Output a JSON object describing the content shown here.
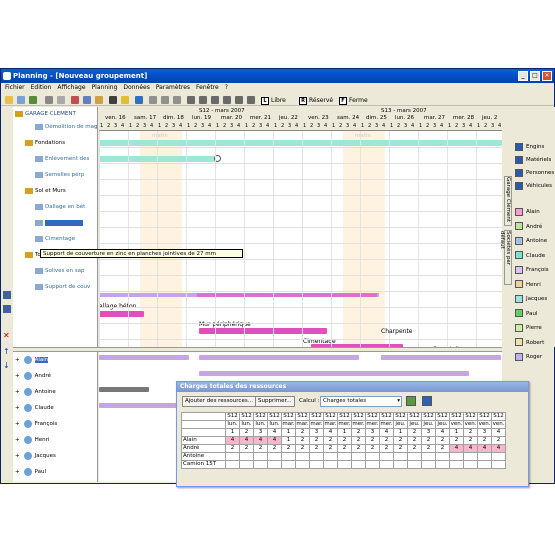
{
  "window": {
    "title": "Planning - [Nouveau groupement]",
    "min": "_",
    "max": "□",
    "close": "✕"
  },
  "menu": [
    "Fichier",
    "Edition",
    "Affichage",
    "Planning",
    "Données",
    "Paramètres",
    "Fenêtre",
    "?"
  ],
  "toolbar": {
    "modes": [
      {
        "key": "L",
        "label": "Libre"
      },
      {
        "key": "R",
        "label": "Réservé"
      },
      {
        "key": "F",
        "label": "Ferme"
      }
    ]
  },
  "timeline": {
    "weeks": [
      {
        "label": "S12 - mars 2007"
      },
      {
        "label": "S13 - mars 2007"
      }
    ],
    "days": [
      "ven. 16",
      "sam. 17",
      "dim. 18",
      "lun. 19",
      "mar. 20",
      "mer. 21",
      "jeu. 22",
      "ven. 23",
      "sam. 24",
      "dim. 25",
      "lun. 26",
      "mar. 27",
      "mer. 28",
      "jeu. 2"
    ],
    "weekend_label": "matin"
  },
  "tree": [
    {
      "label": "GARAGE CLEMENT",
      "level": 0
    },
    {
      "label": "Démolition de mag",
      "level": 2
    },
    {
      "label": "Fondations",
      "level": 1
    },
    {
      "label": "Enlèvement des",
      "level": 2
    },
    {
      "label": "Semelles pérp",
      "level": 2
    },
    {
      "label": "Sol et Murs",
      "level": 1
    },
    {
      "label": "Dallage en bét",
      "level": 2
    },
    {
      "label": "Mur en parpai",
      "level": 2,
      "selected": true
    },
    {
      "label": "Cimentage",
      "level": 2
    },
    {
      "label": "Toiture",
      "level": 1
    },
    {
      "label": "Solives en sap",
      "level": 2
    },
    {
      "label": "Support de couv",
      "level": 2
    }
  ],
  "gantt_labels": {
    "dallage": "allage béton",
    "mur": "Mur périphérique",
    "cimentage": "Cimentage",
    "charpente": "Charpente",
    "soustoiture": "Sous-toiture"
  },
  "tooltip": "Support de couverture en zinc en planches jointives de 27 mm",
  "right_panel": {
    "tab1": "Garage Clément",
    "tab2": "Sociétés par défaut",
    "tab3": "Ressources",
    "categories": [
      {
        "label": "Engins"
      },
      {
        "label": "Matériels"
      },
      {
        "label": "Personnes"
      },
      {
        "label": "Véhicules"
      }
    ],
    "people": [
      {
        "label": "Alain",
        "color": "#f0a0d0"
      },
      {
        "label": "André",
        "color": "#c0e0a0"
      },
      {
        "label": "Antoine",
        "color": "#a0c0f0"
      },
      {
        "label": "Claude",
        "color": "#80e0d0"
      },
      {
        "label": "François",
        "color": "#e0c0f0"
      },
      {
        "label": "Henri",
        "color": "#f0d0a0"
      },
      {
        "label": "Jacques",
        "color": "#a0e0e0"
      },
      {
        "label": "Paul",
        "color": "#60d060"
      },
      {
        "label": "Pierre",
        "color": "#d0f0a0"
      },
      {
        "label": "Robert",
        "color": "#f0e0b0"
      },
      {
        "label": "Roger",
        "color": "#c0b0f0"
      }
    ]
  },
  "resources": [
    "Alain",
    "André",
    "Antoine",
    "Claude",
    "François",
    "Henri",
    "Jacques",
    "Paul"
  ],
  "dialog": {
    "title": "Charges totales des ressources",
    "add_button": "Ajouter des ressources...",
    "remove_button": "Supprimer...",
    "calc_label": "Calcul :",
    "calc_value": "Charges totales",
    "col_weeks": [
      "S12",
      "S12",
      "S12",
      "S12",
      "S12",
      "S12",
      "S12",
      "S12",
      "S12",
      "S12",
      "S12",
      "S12",
      "S12",
      "S12",
      "S12",
      "S12",
      "S12",
      "S12",
      "S12",
      "S12"
    ],
    "col_days": [
      "lun.",
      "lun.",
      "lun.",
      "lun.",
      "mar.",
      "mar.",
      "mar.",
      "mar.",
      "mer.",
      "mer.",
      "mer.",
      "mer.",
      "jeu.",
      "jeu.",
      "jeu.",
      "jeu.",
      "ven.",
      "ven.",
      "ven.",
      "ven."
    ],
    "col_nums": [
      "1",
      "2",
      "3",
      "4",
      "1",
      "2",
      "3",
      "4",
      "1",
      "2",
      "3",
      "4",
      "1",
      "2",
      "3",
      "4",
      "1",
      "2",
      "3",
      "4"
    ],
    "rows": [
      {
        "name": "Alain",
        "cells": [
          "4",
          "4",
          "4",
          "4",
          "1",
          "2",
          "2",
          "2",
          "2",
          "2",
          "2",
          "2",
          "2",
          "2",
          "2",
          "2",
          "2",
          "2",
          "2",
          "2"
        ]
      },
      {
        "name": "André",
        "cells": [
          "2",
          "2",
          "2",
          "2",
          "2",
          "2",
          "2",
          "2",
          "2",
          "2",
          "2",
          "2",
          "2",
          "2",
          "2",
          "2",
          "4",
          "4",
          "4",
          "4"
        ]
      },
      {
        "name": "Antoine",
        "cells": [
          "",
          "",
          "",
          "",
          "",
          "",
          "",
          "",
          "",
          "",
          "",
          "",
          "",
          "",
          "",
          "",
          "",
          "",
          "",
          ""
        ]
      },
      {
        "name": "Camion 15T",
        "cells": [
          "",
          "",
          "",
          "",
          "",
          "",
          "",
          "",
          "",
          "",
          "",
          "",
          "",
          "",
          "",
          "",
          "",
          "",
          "",
          ""
        ]
      }
    ]
  }
}
